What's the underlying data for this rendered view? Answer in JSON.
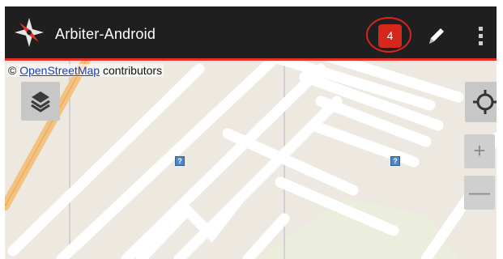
{
  "actionbar": {
    "title": "Arbiter-Android",
    "logo_icon": "compass-app-icon",
    "notification_count": "4",
    "edit_icon": "pencil-icon",
    "overflow_icon": "overflow-menu-icon",
    "accent_color": "#e53125",
    "badge_color": "#d6271d"
  },
  "map": {
    "attribution_link": "OpenStreetMap",
    "attribution_text": " contributors",
    "attribution_symbol": "©",
    "controls": {
      "layers_icon": "layers-icon",
      "locate_icon": "crosshair-icon",
      "zoom_in": "+",
      "zoom_out": "—"
    },
    "poi_marker": "?"
  }
}
